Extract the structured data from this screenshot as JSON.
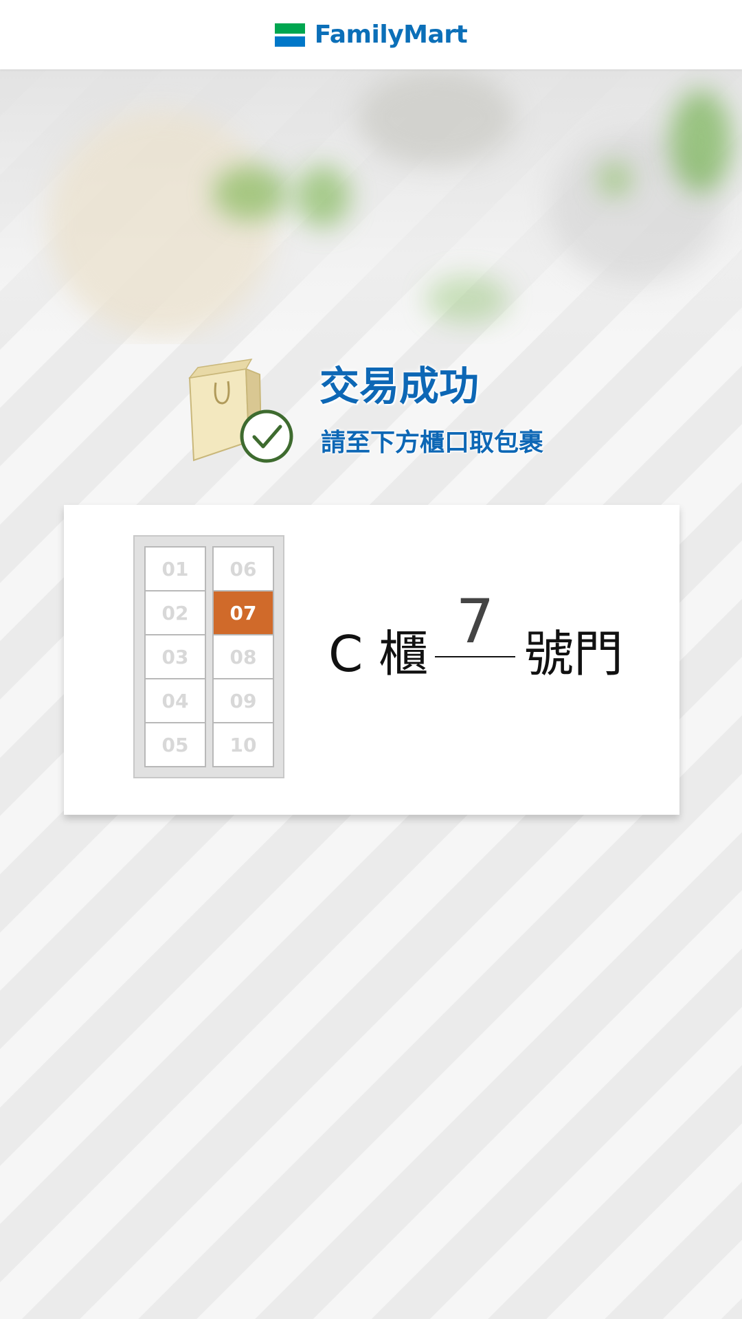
{
  "header": {
    "brand_name": "FamilyMart",
    "brand_colors": {
      "green": "#00a650",
      "blue": "#0077c8",
      "text": "#0b6fb8"
    }
  },
  "status": {
    "title": "交易成功",
    "subtitle": "請至下方櫃口取包裹",
    "icons": [
      "shopping-bag-icon",
      "check-circle-icon"
    ],
    "accent_color": "#0d67b5"
  },
  "locker": {
    "cells": [
      "01",
      "02",
      "03",
      "04",
      "05",
      "06",
      "07",
      "08",
      "09",
      "10"
    ],
    "selected": "07",
    "selected_color": "#d06a2a"
  },
  "pickup": {
    "cabinet_label": "C 櫃",
    "door_number": "7",
    "door_label": "號門"
  }
}
